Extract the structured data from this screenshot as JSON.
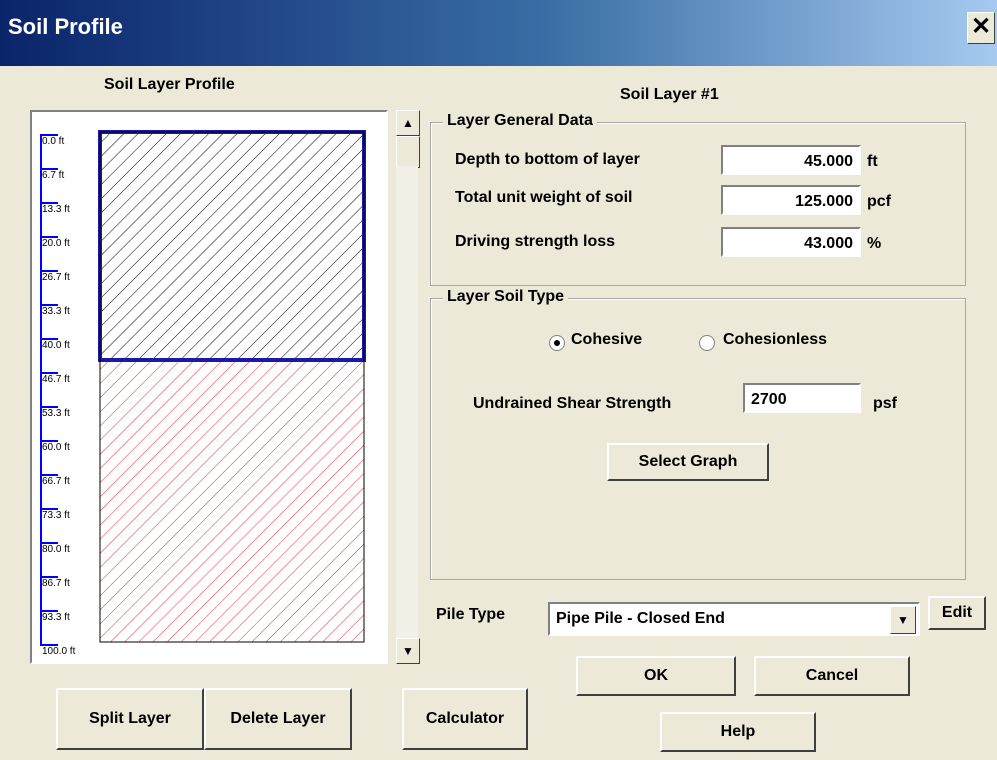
{
  "window": {
    "title": "Soil Profile",
    "close_glyph": "✕"
  },
  "profile": {
    "heading": "Soil Layer Profile",
    "scale_ticks": [
      "0.0 ft",
      "6.7 ft",
      "13.3 ft",
      "20.0 ft",
      "26.7 ft",
      "33.3 ft",
      "40.0 ft",
      "46.7 ft",
      "53.3 ft",
      "60.0 ft",
      "66.7 ft",
      "73.3 ft",
      "80.0 ft",
      "86.7 ft",
      "93.3 ft",
      "100.0 ft"
    ],
    "layers": [
      {
        "id": 1,
        "top_ft": 0,
        "bottom_ft": 45,
        "pattern_color": "#000000",
        "selected": true
      },
      {
        "id": 2,
        "top_ft": 45,
        "bottom_ft": 100,
        "pattern_color": "#e03030",
        "selected": false
      }
    ]
  },
  "layer_title": "Soil Layer #1",
  "general": {
    "legend": "Layer General Data",
    "depth": {
      "label": "Depth to bottom of layer",
      "value": "45.000",
      "unit": "ft"
    },
    "unit_weight": {
      "label": "Total unit weight of soil",
      "value": "125.000",
      "unit": "pcf"
    },
    "strength_loss": {
      "label": "Driving strength loss",
      "value": "43.000",
      "unit": "%"
    }
  },
  "soil_type": {
    "legend": "Layer Soil Type",
    "cohesive_label": "Cohesive",
    "cohesionless_label": "Cohesionless",
    "selected": "Cohesive",
    "shear": {
      "label": "Undrained Shear Strength",
      "value": "2700",
      "unit": "psf"
    },
    "select_graph_label": "Select Graph"
  },
  "pile": {
    "label": "Pile Type",
    "selected": "Pipe Pile - Closed End",
    "edit_label": "Edit"
  },
  "buttons": {
    "ok": "OK",
    "cancel": "Cancel",
    "help": "Help",
    "split": "Split Layer",
    "delete": "Delete Layer",
    "calculator": "Calculator"
  },
  "colors": {
    "selected_border": "#1a1aa6",
    "scale_blue": "#0000ff"
  }
}
